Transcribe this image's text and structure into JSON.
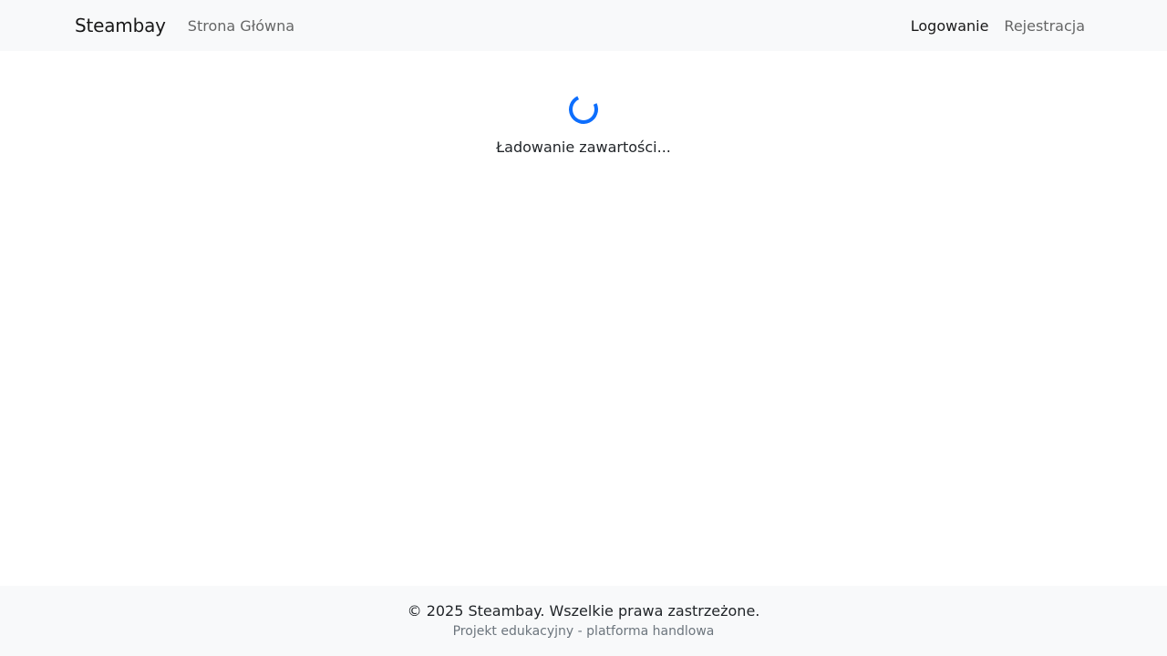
{
  "navbar": {
    "brand": "Steambay",
    "links": {
      "home": "Strona Główna",
      "login": "Logowanie",
      "register": "Rejestracja"
    }
  },
  "main": {
    "loading_text": "Ładowanie zawartości..."
  },
  "footer": {
    "copyright": "© 2025 Steambay. Wszelkie prawa zastrzeżone.",
    "subtitle": "Projekt edukacyjny - platforma handlowa"
  },
  "colors": {
    "accent": "#0d6efd",
    "navbar_bg": "#f8f9fa",
    "footer_bg": "#f8f9fa"
  },
  "icons": {
    "spinner": "loading-spinner-icon"
  }
}
